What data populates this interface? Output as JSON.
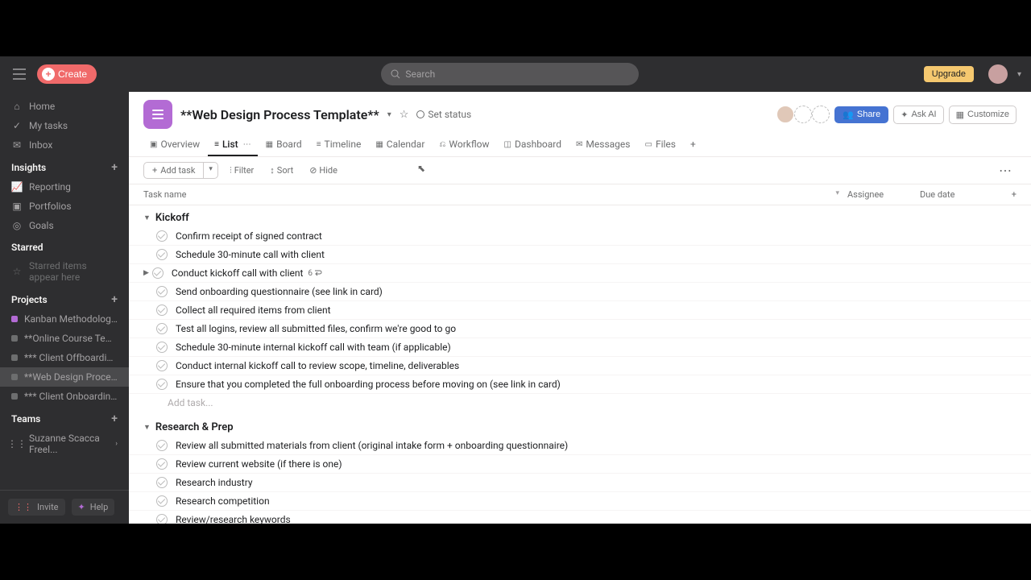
{
  "topbar": {
    "create": "Create",
    "search_placeholder": "Search",
    "upgrade": "Upgrade"
  },
  "sidebar": {
    "nav": [
      {
        "label": "Home",
        "icon": "home"
      },
      {
        "label": "My tasks",
        "icon": "check"
      },
      {
        "label": "Inbox",
        "icon": "bell"
      }
    ],
    "insights_label": "Insights",
    "insights": [
      {
        "label": "Reporting",
        "icon": "chart"
      },
      {
        "label": "Portfolios",
        "icon": "folder"
      },
      {
        "label": "Goals",
        "icon": "target"
      }
    ],
    "starred_label": "Starred",
    "starred_empty": "Starred items appear here",
    "projects_label": "Projects",
    "projects": [
      {
        "label": "Kanban Methodology Exa...",
        "color": "#b36bd4"
      },
      {
        "label": "**Online Course Template**",
        "color": "#6d6e6f"
      },
      {
        "label": "*** Client Offboarding Te...",
        "color": "#6d6e6f"
      },
      {
        "label": "**Web Design Process Te...",
        "color": "#6d6e6f",
        "active": true
      },
      {
        "label": "*** Client Onboarding Te...",
        "color": "#6d6e6f"
      }
    ],
    "teams_label": "Teams",
    "teams": [
      {
        "label": "Suzanne Scacca Freel..."
      }
    ],
    "invite": "Invite",
    "help": "Help"
  },
  "project": {
    "title": "**Web Design Process Template**",
    "set_status": "Set status",
    "share": "Share",
    "ask_ai": "Ask AI",
    "customize": "Customize"
  },
  "tabs": [
    {
      "label": "Overview",
      "icon": "overview"
    },
    {
      "label": "List",
      "icon": "list",
      "active": true
    },
    {
      "label": "Board",
      "icon": "board"
    },
    {
      "label": "Timeline",
      "icon": "timeline"
    },
    {
      "label": "Calendar",
      "icon": "calendar"
    },
    {
      "label": "Workflow",
      "icon": "workflow"
    },
    {
      "label": "Dashboard",
      "icon": "dashboard"
    },
    {
      "label": "Messages",
      "icon": "messages"
    },
    {
      "label": "Files",
      "icon": "files"
    }
  ],
  "toolbar": {
    "add_task": "Add task",
    "filter": "Filter",
    "sort": "Sort",
    "hide": "Hide"
  },
  "columns": {
    "task": "Task name",
    "assignee": "Assignee",
    "due": "Due date"
  },
  "sections": [
    {
      "name": "Kickoff",
      "tasks": [
        {
          "title": "Confirm receipt of signed contract"
        },
        {
          "title": "Schedule 30-minute call with client"
        },
        {
          "title": "Conduct kickoff call with client",
          "subtasks": 6,
          "has_children": true
        },
        {
          "title": "Send onboarding questionnaire (see link in card)"
        },
        {
          "title": "Collect all required items from client"
        },
        {
          "title": "Test all logins, review all submitted files, confirm we're good to go"
        },
        {
          "title": "Schedule 30-minute internal kickoff call with team (if applicable)"
        },
        {
          "title": "Conduct internal kickoff call to review scope, timeline, deliverables"
        },
        {
          "title": "Ensure that you completed the full onboarding process before moving on (see link in card)"
        }
      ],
      "add": "Add task..."
    },
    {
      "name": "Research & Prep",
      "tasks": [
        {
          "title": "Review all submitted materials from client (original intake form + onboarding questionnaire)"
        },
        {
          "title": "Review current website (if there is one)"
        },
        {
          "title": "Research industry"
        },
        {
          "title": "Research competition"
        },
        {
          "title": "Review/research keywords"
        }
      ]
    }
  ]
}
